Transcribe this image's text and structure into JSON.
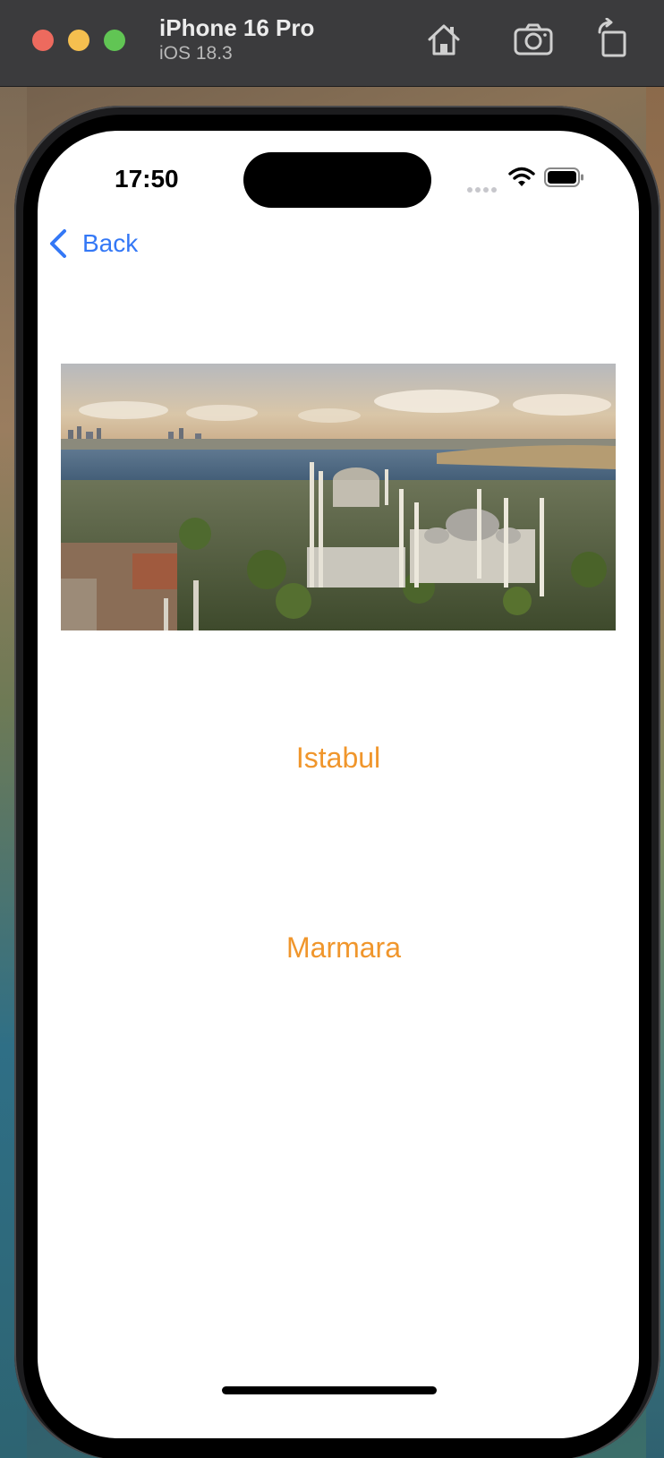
{
  "simulator": {
    "device_name": "iPhone 16 Pro",
    "os_version": "iOS 18.3",
    "buttons": [
      {
        "icon": "home-icon"
      },
      {
        "icon": "camera-icon"
      },
      {
        "icon": "rotate-icon"
      }
    ]
  },
  "status_bar": {
    "time": "17:50",
    "icons": [
      "signal-dots-icon",
      "wifi-icon",
      "battery-icon"
    ]
  },
  "nav": {
    "back_label": "Back",
    "back_icon": "chevron-left-icon"
  },
  "content": {
    "image_subject": "panoramic-city-photo",
    "labels": [
      "Istabul",
      "Marmara"
    ]
  },
  "colors": {
    "accent": "#3478f6",
    "label": "#f0962c",
    "titlebar": "#3b3b3d"
  }
}
